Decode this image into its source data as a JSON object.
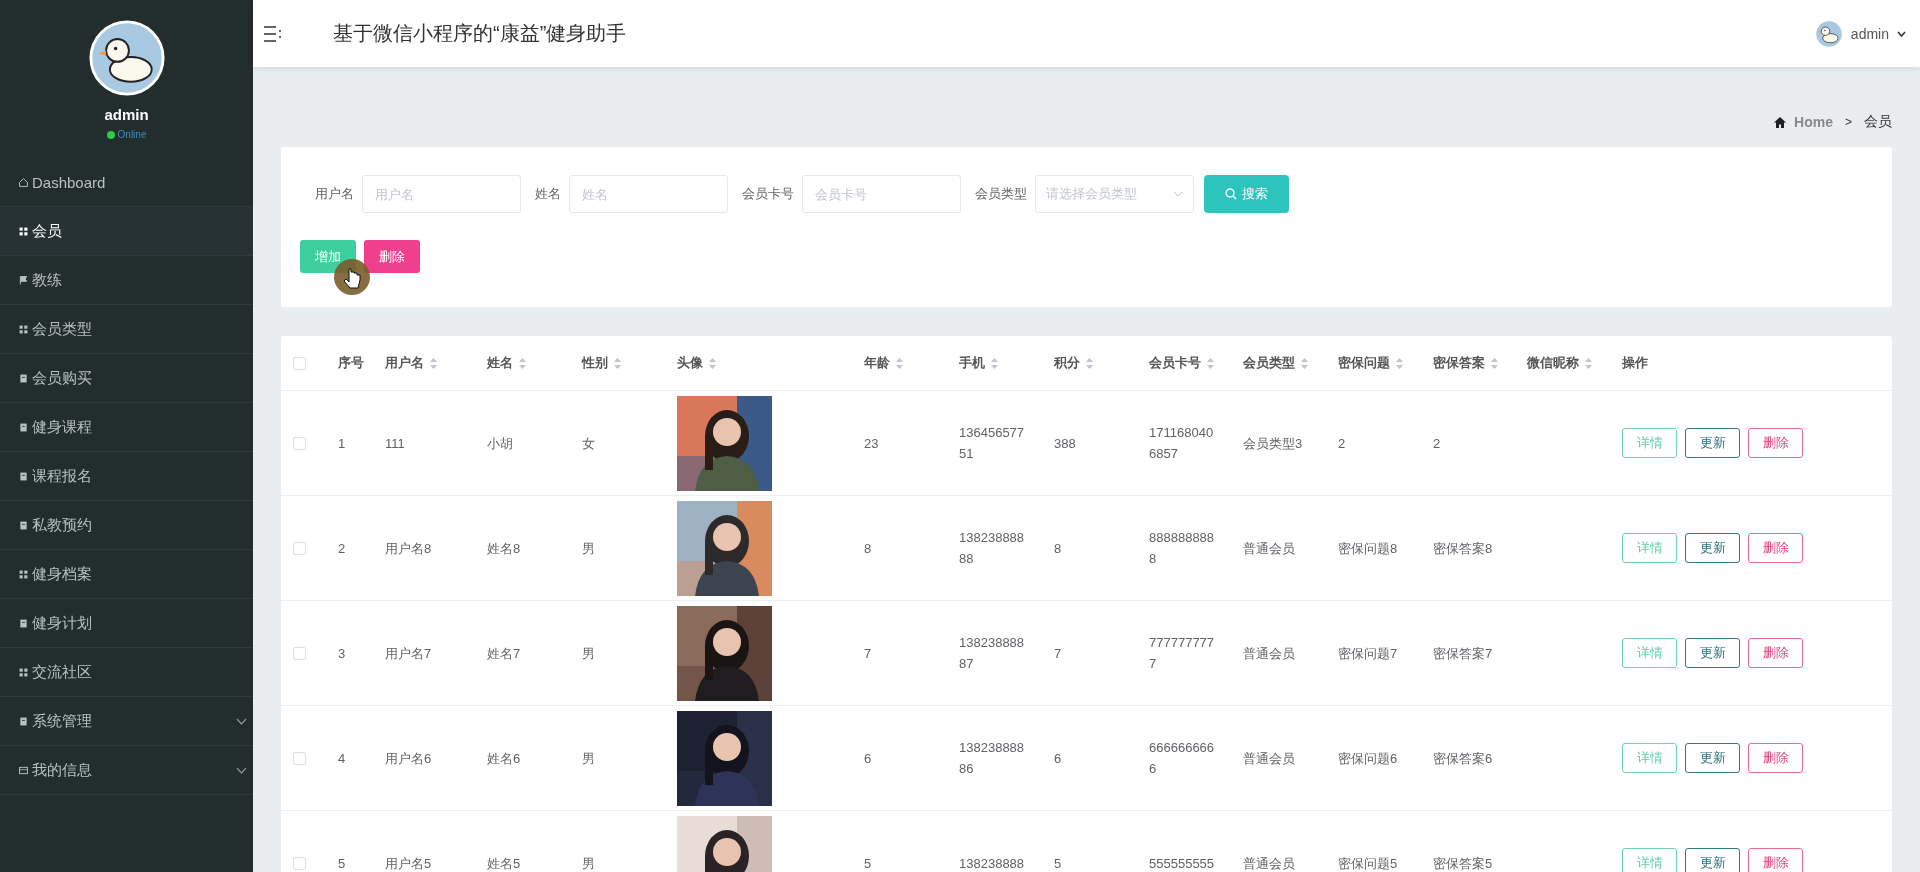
{
  "sidebar": {
    "user": {
      "name": "admin",
      "status": "Online"
    },
    "items": [
      {
        "label": "Dashboard",
        "kind": "link",
        "selected": false
      },
      {
        "label": "会员",
        "kind": "link",
        "selected": true
      },
      {
        "label": "教练",
        "kind": "link",
        "selected": false
      },
      {
        "label": "会员类型",
        "kind": "link",
        "selected": false
      },
      {
        "label": "会员购买",
        "kind": "link",
        "selected": false
      },
      {
        "label": "健身课程",
        "kind": "link",
        "selected": false
      },
      {
        "label": "课程报名",
        "kind": "link",
        "selected": false
      },
      {
        "label": "私教预约",
        "kind": "link",
        "selected": false
      },
      {
        "label": "健身档案",
        "kind": "link",
        "selected": false
      },
      {
        "label": "健身计划",
        "kind": "link",
        "selected": false
      },
      {
        "label": "交流社区",
        "kind": "link",
        "selected": false
      },
      {
        "label": "系统管理",
        "kind": "group",
        "selected": false,
        "expanded": false
      },
      {
        "label": "我的信息",
        "kind": "group",
        "selected": false,
        "expanded": false
      }
    ]
  },
  "header": {
    "title": "基于微信小程序的“康益”健身助手",
    "user": "admin"
  },
  "breadcrumb": {
    "items": [
      "Home",
      "会员"
    ],
    "separator": ">"
  },
  "search": {
    "fields": [
      {
        "label": "用户名",
        "placeholder": "用户名",
        "kind": "input"
      },
      {
        "label": "姓名",
        "placeholder": "姓名",
        "kind": "input"
      },
      {
        "label": "会员卡号",
        "placeholder": "会员卡号",
        "kind": "input"
      },
      {
        "label": "会员类型",
        "placeholder": "请选择会员类型",
        "kind": "select"
      }
    ],
    "search_button": "搜索",
    "actions": [
      {
        "label": "增加",
        "kind": "add"
      },
      {
        "label": "删除",
        "kind": "delete"
      }
    ]
  },
  "table": {
    "select_all": {
      "checked": false
    },
    "columns": [
      {
        "label": "序号",
        "kind": "plain"
      },
      {
        "label": "用户名",
        "kind": "sortable"
      },
      {
        "label": "姓名",
        "kind": "sortable"
      },
      {
        "label": "性别",
        "kind": "sortable"
      },
      {
        "label": "头像",
        "kind": "sortable"
      },
      {
        "label": "年龄",
        "kind": "sortable"
      },
      {
        "label": "手机",
        "kind": "sortable"
      },
      {
        "label": "积分",
        "kind": "sortable"
      },
      {
        "label": "会员卡号",
        "kind": "sortable"
      },
      {
        "label": "会员类型",
        "kind": "sortable"
      },
      {
        "label": "密保问题",
        "kind": "sortable"
      },
      {
        "label": "密保答案",
        "kind": "sortable"
      },
      {
        "label": "微信昵称",
        "kind": "sortable"
      },
      {
        "label": "操作",
        "kind": "plain"
      }
    ],
    "rows": [
      {
        "checked": false,
        "cells": [
          "1",
          "111",
          "小胡",
          "女",
          {
            "kind": "picture"
          },
          "23",
          "13645657751",
          "388",
          "1711680406857",
          "会员类型3",
          "2",
          "2"
        ],
        "actions": [
          {
            "label": "详情",
            "kind": "detail"
          },
          {
            "label": "更新",
            "kind": "update"
          },
          {
            "label": "删除",
            "kind": "delete"
          }
        ]
      },
      {
        "checked": false,
        "cells": [
          "2",
          "用户名8",
          "姓名8",
          "男",
          {
            "kind": "picture"
          },
          "8",
          "13823888888",
          "8",
          "8888888888",
          "普通会员",
          "密保问题8",
          "密保答案8"
        ],
        "actions": [
          {
            "label": "详情",
            "kind": "detail"
          },
          {
            "label": "更新",
            "kind": "update"
          },
          {
            "label": "删除",
            "kind": "delete"
          }
        ]
      },
      {
        "checked": false,
        "cells": [
          "3",
          "用户名7",
          "姓名7",
          "男",
          {
            "kind": "picture"
          },
          "7",
          "13823888887",
          "7",
          "7777777777",
          "普通会员",
          "密保问题7",
          "密保答案7"
        ],
        "actions": [
          {
            "label": "详情",
            "kind": "detail"
          },
          {
            "label": "更新",
            "kind": "update"
          },
          {
            "label": "删除",
            "kind": "delete"
          }
        ]
      },
      {
        "checked": false,
        "cells": [
          "4",
          "用户名6",
          "姓名6",
          "男",
          {
            "kind": "picture"
          },
          "6",
          "13823888886",
          "6",
          "6666666666",
          "普通会员",
          "密保问题6",
          "密保答案6"
        ],
        "actions": [
          {
            "label": "详情",
            "kind": "detail"
          },
          {
            "label": "更新",
            "kind": "update"
          },
          {
            "label": "删除",
            "kind": "delete"
          }
        ]
      },
      {
        "checked": false,
        "cells": [
          "5",
          "用户名5",
          "姓名5",
          "男",
          {
            "kind": "picture"
          },
          "5",
          "138238888",
          "5",
          "555555555",
          "普通会员",
          "密保问题5",
          "密保答案5"
        ],
        "actions": [
          {
            "label": "详情",
            "kind": "detail"
          },
          {
            "label": "更新",
            "kind": "update"
          },
          {
            "label": "删除",
            "kind": "delete"
          }
        ]
      }
    ]
  }
}
